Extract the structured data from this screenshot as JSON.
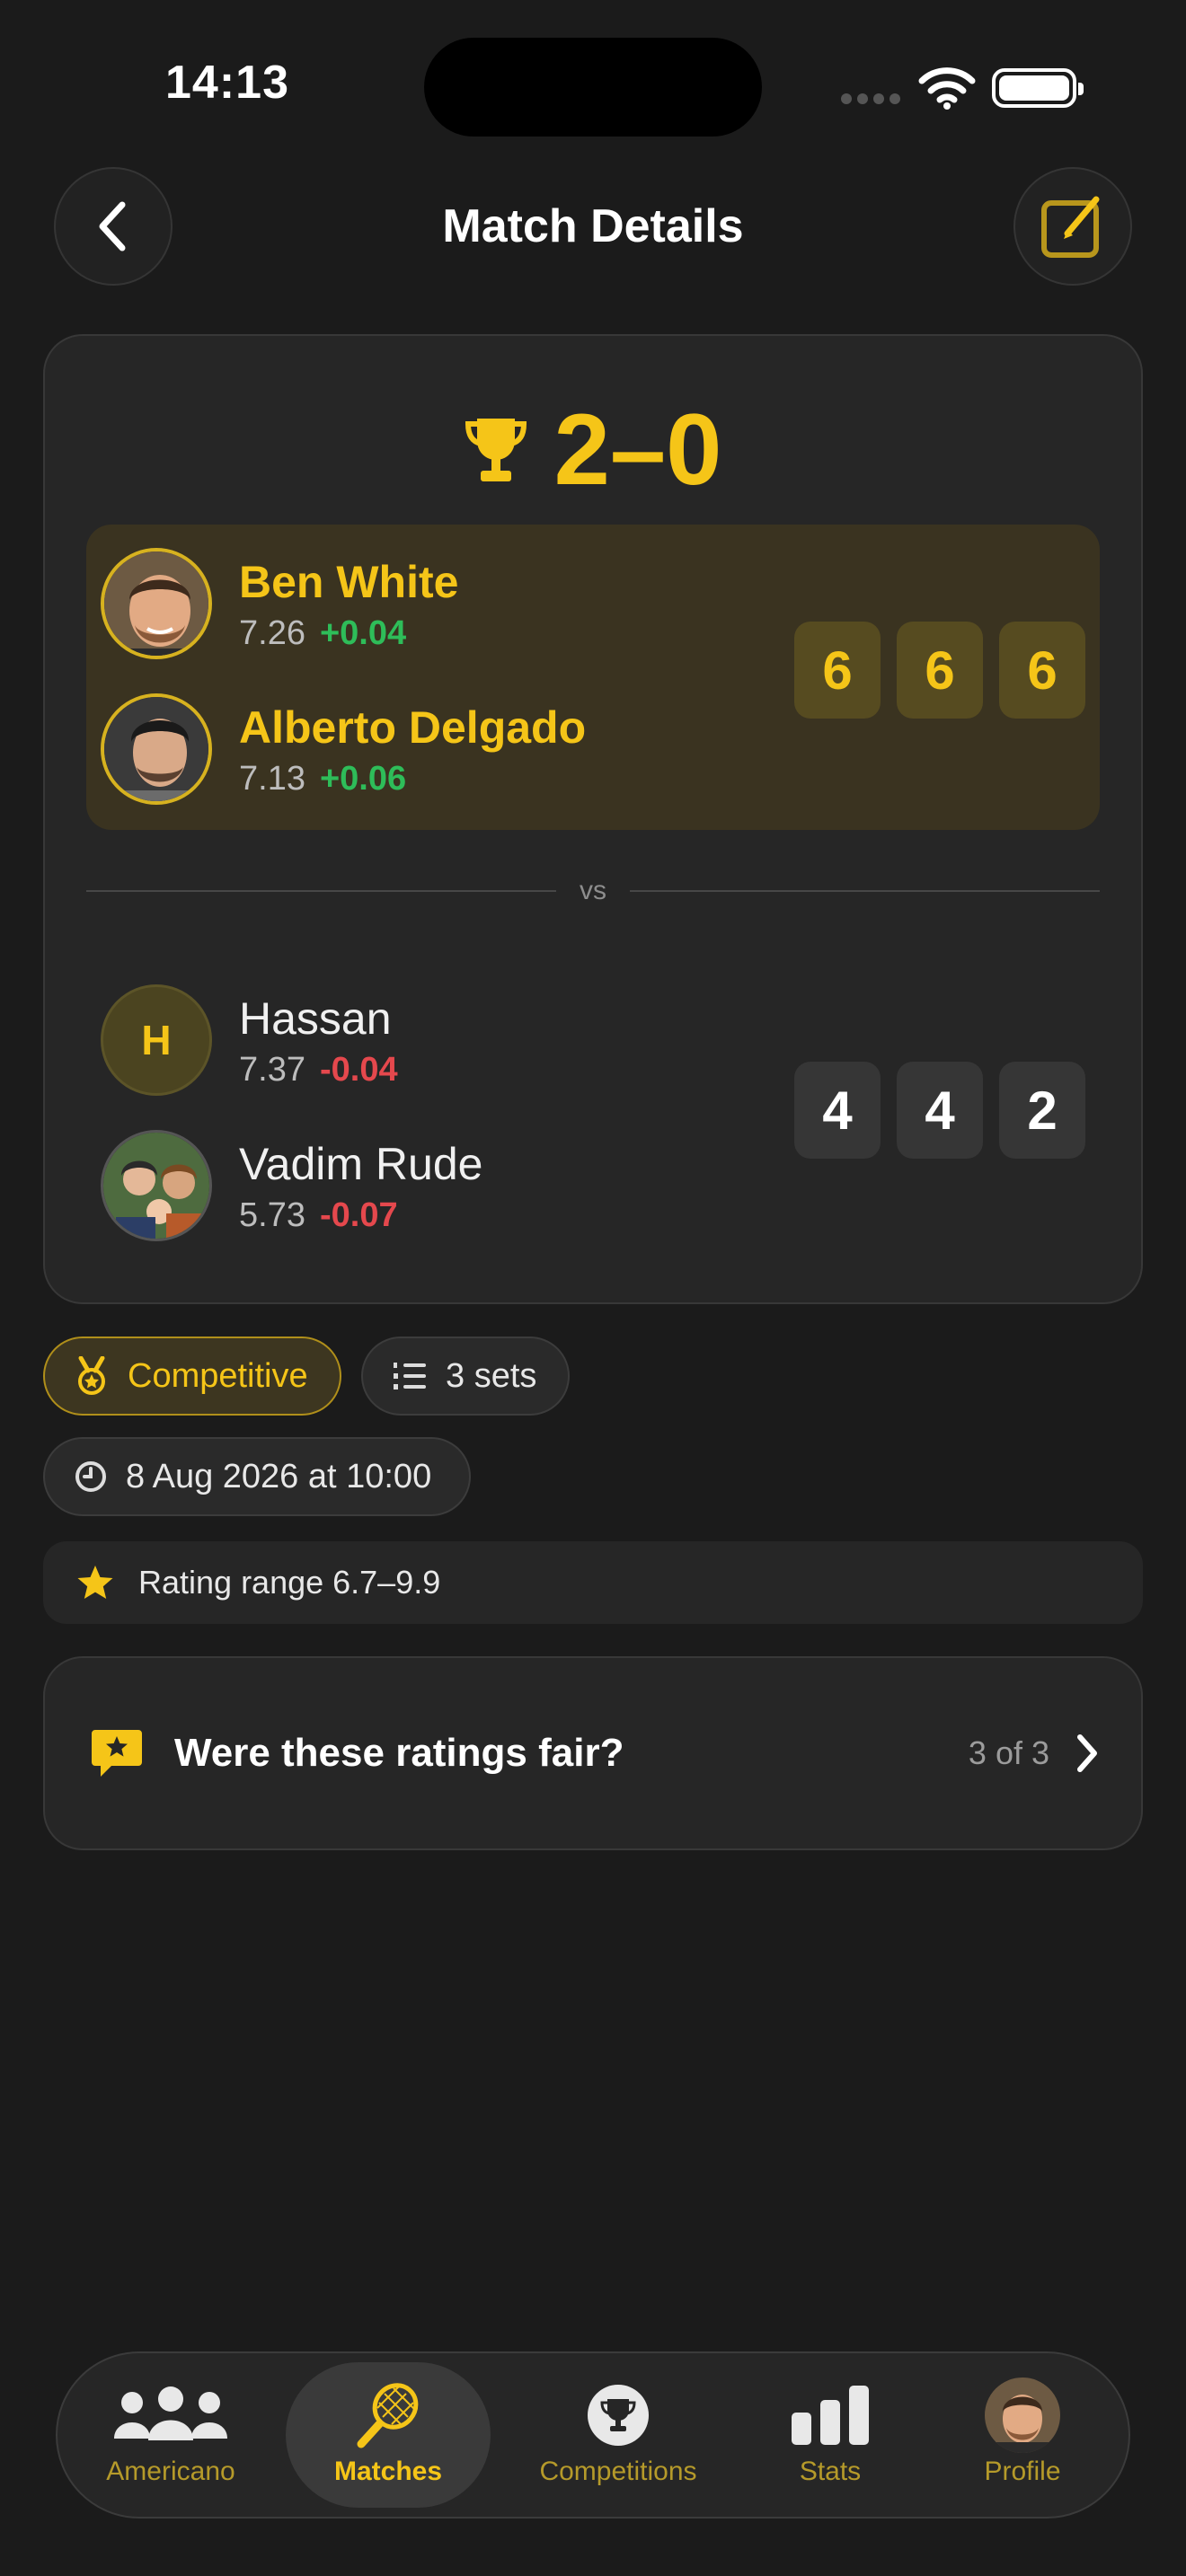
{
  "status": {
    "time": "14:13"
  },
  "header": {
    "title": "Match Details"
  },
  "match": {
    "score": "2–0",
    "winners": {
      "sets": [
        "6",
        "6",
        "6"
      ],
      "players": [
        {
          "name": "Ben White",
          "rating": "7.26",
          "delta": "+0.04"
        },
        {
          "name": "Alberto Delgado",
          "rating": "7.13",
          "delta": "+0.06"
        }
      ]
    },
    "vs": "vs",
    "losers": {
      "sets": [
        "4",
        "4",
        "2"
      ],
      "players": [
        {
          "name": "Hassan",
          "initial": "H",
          "rating": "7.37",
          "delta": "-0.04"
        },
        {
          "name": "Vadim Rude",
          "rating": "5.73",
          "delta": "-0.07"
        }
      ]
    }
  },
  "chips": {
    "type": "Competitive",
    "sets": "3 sets",
    "date": "8 Aug 2026 at 10:00"
  },
  "rating_range": "Rating range 6.7–9.9",
  "fairness": {
    "question": "Were these ratings fair?",
    "count": "3 of 3"
  },
  "tabs": [
    {
      "label": "Americano",
      "icon": "people-icon",
      "active": false
    },
    {
      "label": "Matches",
      "icon": "racket-icon",
      "active": true
    },
    {
      "label": "Competitions",
      "icon": "trophy-icon",
      "active": false
    },
    {
      "label": "Stats",
      "icon": "bar-chart-icon",
      "active": false
    },
    {
      "label": "Profile",
      "icon": "avatar",
      "active": false
    }
  ],
  "colors": {
    "accent": "#f5c518",
    "positive": "#2ebd59",
    "negative": "#e5484d",
    "background": "#1b1b1b"
  }
}
